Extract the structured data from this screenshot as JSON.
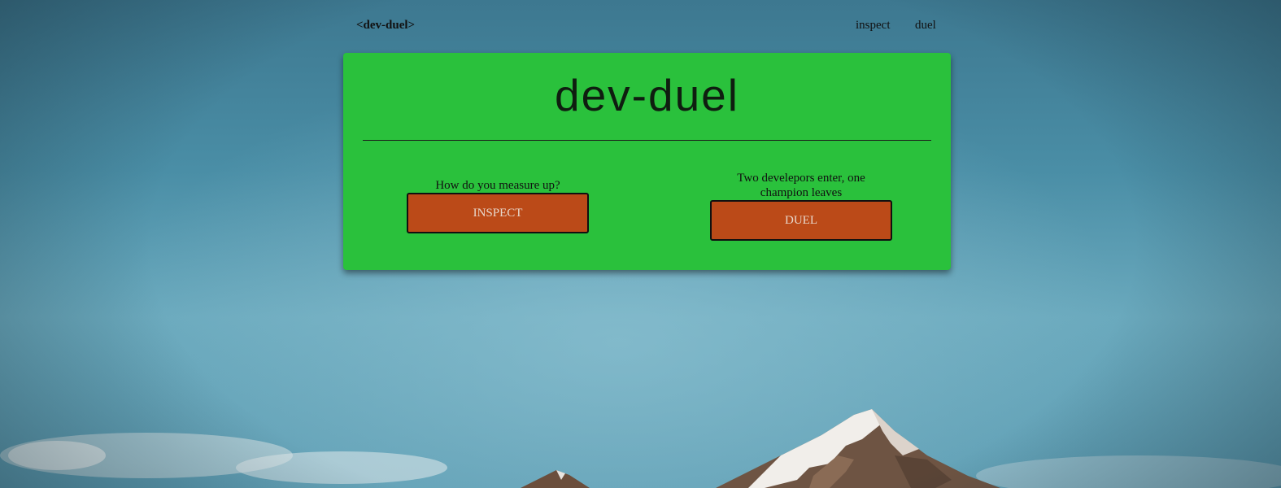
{
  "nav": {
    "brand": "<dev-duel>",
    "links": [
      "inspect",
      "duel"
    ]
  },
  "card": {
    "title": "dev-duel",
    "inspect": {
      "tagline": "How do you measure up?",
      "button_label": "INSPECT"
    },
    "duel": {
      "tagline": "Two develepors enter, one champion leaves",
      "button_label": "DUEL"
    }
  },
  "colors": {
    "card_background": "#2ac13c",
    "button_background": "#bb4a18",
    "sky": "#4a8ea6"
  },
  "icons": {
    "background": "mountain-landscape"
  }
}
